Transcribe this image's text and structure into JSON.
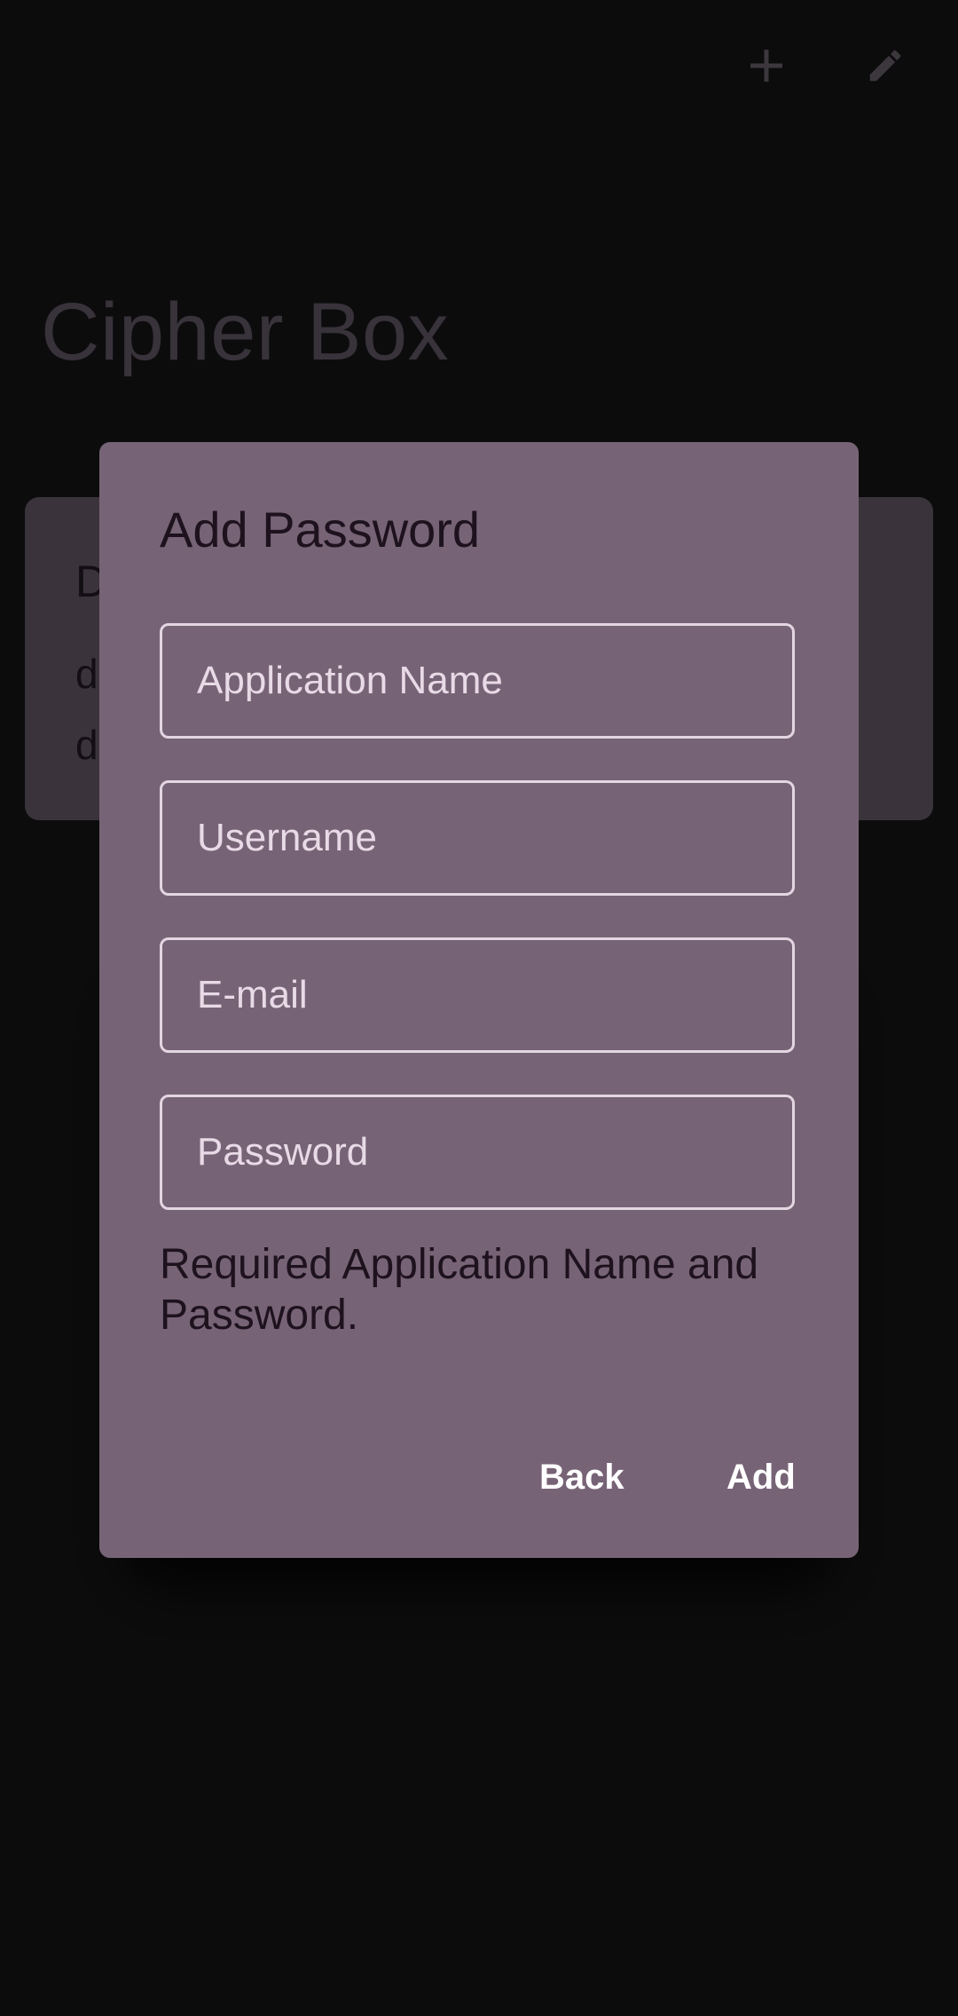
{
  "app": {
    "title": "Cipher Box",
    "actions": {
      "add_icon": "plus-icon",
      "edit_icon": "pencil-icon"
    }
  },
  "background_card": {
    "title_partial": "D",
    "line1_partial": "d",
    "line2_partial": "d"
  },
  "dialog": {
    "title": "Add Password",
    "fields": {
      "application_name": {
        "placeholder": "Application Name",
        "value": ""
      },
      "username": {
        "placeholder": "Username",
        "value": ""
      },
      "email": {
        "placeholder": "E-mail",
        "value": ""
      },
      "password": {
        "placeholder": "Password",
        "value": ""
      }
    },
    "validation_message": "Required Application Name and Password.",
    "buttons": {
      "back": "Back",
      "add": "Add"
    }
  },
  "colors": {
    "screen_background": "#0c0c0d",
    "dialog_background": "#776376",
    "scrim_card": "#3a333b",
    "field_border": "#e3d6e1",
    "dialog_text": "#1d121d",
    "button_text": "#ffffff"
  }
}
